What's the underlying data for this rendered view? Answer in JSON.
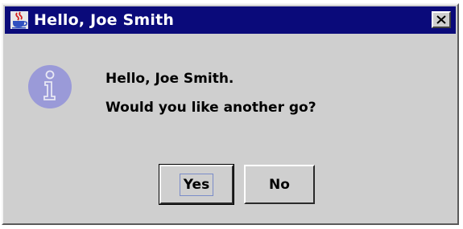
{
  "window": {
    "title": "Hello, Joe Smith",
    "title_icon": "java-cup-icon",
    "close_icon": "close-icon",
    "colors": {
      "titlebar": "#0a0a7a",
      "title_text": "#ffffff",
      "background": "#cfcfcf",
      "info_icon": "#9a9ad8"
    }
  },
  "dialog": {
    "icon": "info-icon",
    "message_line_1": "Hello, Joe Smith.",
    "message_line_2": "Would you like another go?"
  },
  "buttons": {
    "yes_label": "Yes",
    "no_label": "No"
  }
}
